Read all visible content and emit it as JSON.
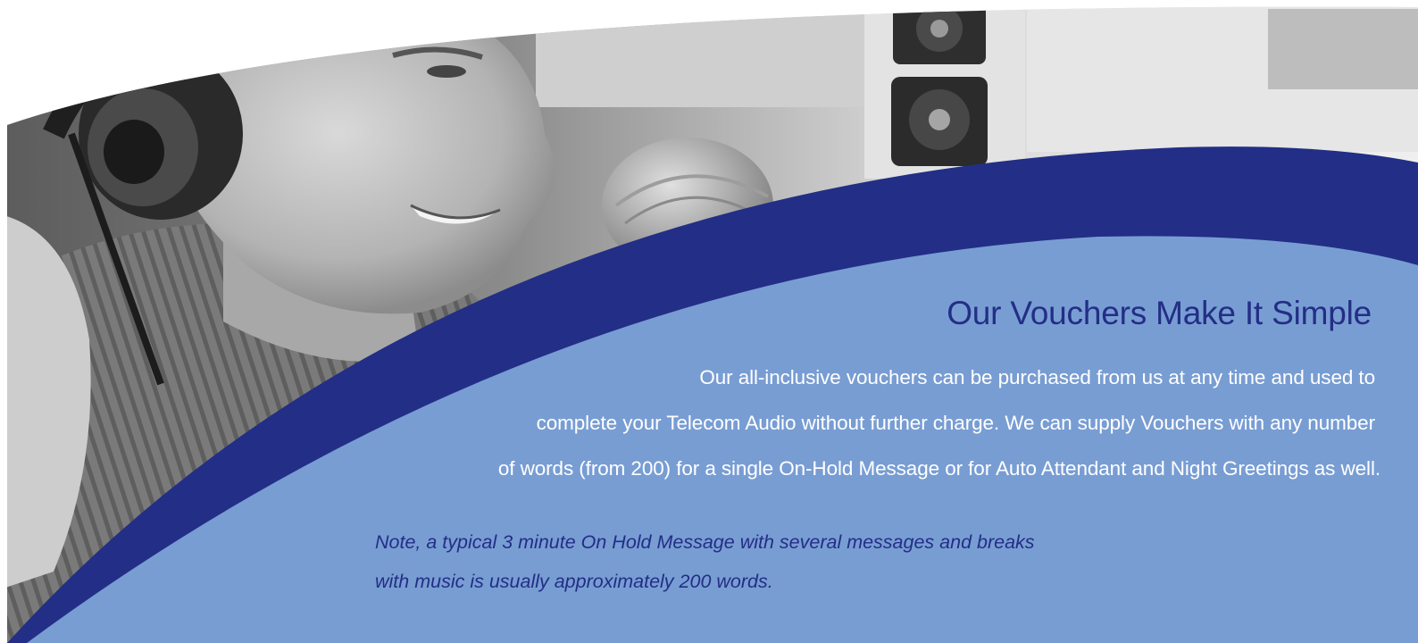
{
  "banner": {
    "heading": "Our Vouchers Make It Simple",
    "body_lines": [
      "Our all-inclusive vouchers can be purchased from us at any time and used to",
      "complete your Telecom Audio without further charge. We can supply Vouchers with any number",
      "of words (from 200) for a single On-Hold Message or for Auto Attendant and Night Greetings as well."
    ],
    "note_lines": [
      "Note, a typical 3 minute On Hold Message with several messages and breaks",
      "with music is usually approximately 200 words."
    ]
  },
  "colors": {
    "dark_blue": "#232e86",
    "light_blue": "#789dd3",
    "text_white": "#ffffff"
  },
  "photo": {
    "subject": "grayscale photo of a man wearing headphones speaking into a studio microphone"
  }
}
